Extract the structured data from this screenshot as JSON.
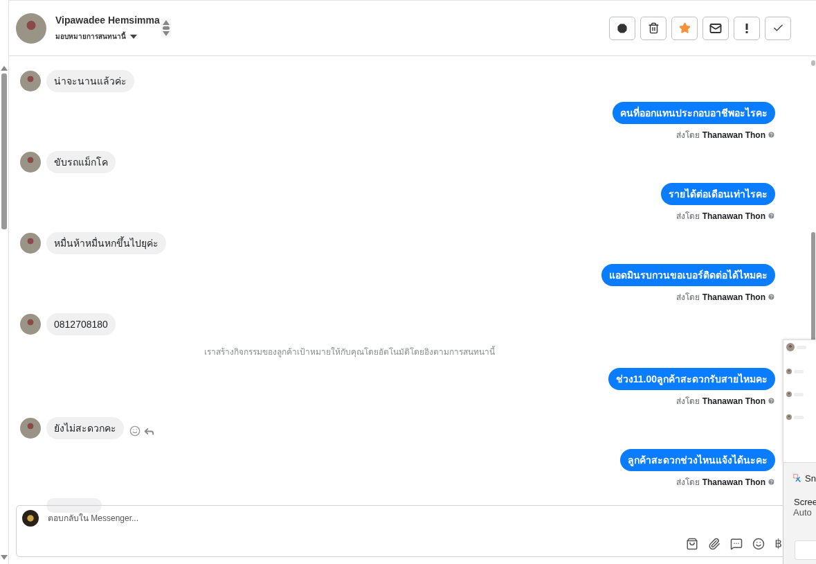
{
  "header": {
    "contact_name": "Vipawadee Hemsimma",
    "assign_label": "มอบหมายการสนทนานี้"
  },
  "messages": [
    {
      "kind": "incoming",
      "text": "น่าจะนานแล้วค่ะ"
    },
    {
      "kind": "outgoing",
      "text": "คนที่ออกแทนประกอบอาชีพอะไรคะ",
      "sent_by_label": "ส่งโดย",
      "sender": "Thanawan Thon"
    },
    {
      "kind": "incoming",
      "text": "ขับรถแม็กโค"
    },
    {
      "kind": "outgoing",
      "text": "รายได้ต่อเดือนเท่าไรคะ",
      "sent_by_label": "ส่งโดย",
      "sender": "Thanawan Thon"
    },
    {
      "kind": "incoming",
      "text": "หมื่นห้าหมื่นหกขึ้นไปยุค่ะ"
    },
    {
      "kind": "outgoing",
      "text": "แอดมินรบกวนขอเบอร์ติดต่อได้ไหมคะ",
      "sent_by_label": "ส่งโดย",
      "sender": "Thanawan Thon"
    },
    {
      "kind": "incoming",
      "text": "0812708180"
    },
    {
      "kind": "system",
      "text": "เราสร้างกิจกรรมของลูกค้าเป้าหมายให้กับคุณโดยอัตโนมัติโดยอิงตามการสนทนานี้"
    },
    {
      "kind": "outgoing",
      "text": "ช่วง11.00ลูกค้าสะดวกรับสายไหมคะ",
      "sent_by_label": "ส่งโดย",
      "sender": "Thanawan Thon"
    },
    {
      "kind": "incoming",
      "text": "ยังไม่สะดวกคะ",
      "hovered": true
    },
    {
      "kind": "outgoing",
      "text": "ลูกค้าสะดวกช่วงไหนแจ้งได้นะคะ",
      "sent_by_label": "ส่งโดย",
      "sender": "Thanawan Thon"
    },
    {
      "kind": "incoming_partial"
    }
  ],
  "composer": {
    "placeholder": "ตอบกลับใน Messenger...",
    "currency_symbol": "฿"
  },
  "notification": {
    "app_name": "Sn",
    "title": "Scree",
    "subtitle": "Auto"
  }
}
